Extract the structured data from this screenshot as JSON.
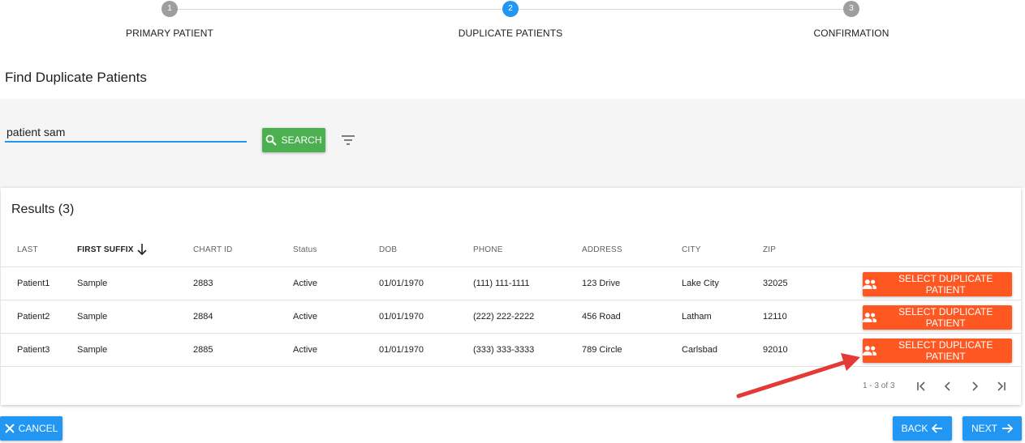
{
  "stepper": {
    "steps": [
      {
        "number": "1",
        "label": "PRIMARY PATIENT",
        "state": "complete"
      },
      {
        "number": "2",
        "label": "DUPLICATE PATIENTS",
        "state": "active"
      },
      {
        "number": "3",
        "label": "CONFIRMATION",
        "state": "pending"
      }
    ]
  },
  "page": {
    "title": "Find Duplicate Patients"
  },
  "search": {
    "value": "patient sam",
    "button_label": "SEARCH"
  },
  "results": {
    "title": "Results (3)",
    "columns": [
      "LAST",
      "FIRST SUFFIX",
      "CHART ID",
      "Status",
      "DOB",
      "PHONE",
      "ADDRESS",
      "CITY",
      "ZIP"
    ],
    "sorted_column": "FIRST SUFFIX",
    "rows": [
      {
        "last": "Patient1",
        "first": "Sample",
        "chart_id": "2883",
        "status": "Active",
        "dob": "01/01/1970",
        "phone": "(111) 111-1111",
        "address": "123 Drive",
        "city": "Lake City",
        "zip": "32025",
        "action": "SELECT DUPLICATE PATIENT"
      },
      {
        "last": "Patient2",
        "first": "Sample",
        "chart_id": "2884",
        "status": "Active",
        "dob": "01/01/1970",
        "phone": "(222) 222-2222",
        "address": "456 Road",
        "city": "Latham",
        "zip": "12110",
        "action": "SELECT DUPLICATE PATIENT"
      },
      {
        "last": "Patient3",
        "first": "Sample",
        "chart_id": "2885",
        "status": "Active",
        "dob": "01/01/1970",
        "phone": "(333) 333-3333",
        "address": "789 Circle",
        "city": "Carlsbad",
        "zip": "92010",
        "action": "SELECT DUPLICATE PATIENT"
      }
    ],
    "pagination": {
      "range": "1 - 3 of 3"
    }
  },
  "footer": {
    "cancel_label": "CANCEL",
    "back_label": "BACK",
    "next_label": "NEXT"
  },
  "colors": {
    "primary": "#2196f3",
    "success": "#4caf50",
    "accent": "#ff5722",
    "annotation_arrow": "#e53935"
  }
}
